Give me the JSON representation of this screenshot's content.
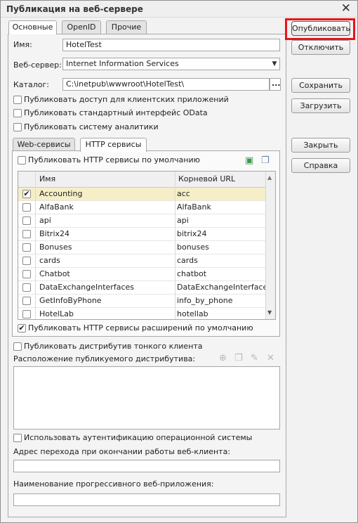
{
  "window": {
    "title": "Публикация на веб-сервере"
  },
  "tabs": [
    {
      "label": "Основные"
    },
    {
      "label": "OpenID"
    },
    {
      "label": "Прочие"
    }
  ],
  "form": {
    "name_label": "Имя:",
    "name_value": "HotelTest",
    "webserver_label": "Веб-сервер:",
    "webserver_value": "Internet Information Services",
    "catalog_label": "Каталог:",
    "catalog_value": "C:\\inetpub\\wwwroot\\HotelTest\\",
    "catalog_button": "...",
    "checks": [
      {
        "label": "Публиковать доступ для клиентских приложений",
        "checked": false
      },
      {
        "label": "Публиковать стандартный интерфейс OData",
        "checked": false
      },
      {
        "label": "Публиковать систему аналитики",
        "checked": false
      }
    ]
  },
  "inner_tabs": [
    {
      "label": "Web-сервисы"
    },
    {
      "label": "HTTP сервисы"
    }
  ],
  "http": {
    "publish_default_label": "Публиковать HTTP сервисы по умолчанию",
    "publish_default_checked": false,
    "col_name": "Имя",
    "col_url": "Корневой URL",
    "rows": [
      {
        "name": "Accounting",
        "url": "acc",
        "checked": true
      },
      {
        "name": "AlfaBank",
        "url": "AlfaBank",
        "checked": false
      },
      {
        "name": "api",
        "url": "api",
        "checked": false
      },
      {
        "name": "Bitrix24",
        "url": "bitrix24",
        "checked": false
      },
      {
        "name": "Bonuses",
        "url": "bonuses",
        "checked": false
      },
      {
        "name": "cards",
        "url": "cards",
        "checked": false
      },
      {
        "name": "Chatbot",
        "url": "chatbot",
        "checked": false
      },
      {
        "name": "DataExchangeInterfaces",
        "url": "DataExchangeInterfaces",
        "checked": false
      },
      {
        "name": "GetInfoByPhone",
        "url": "info_by_phone",
        "checked": false
      },
      {
        "name": "HotelLab",
        "url": "hotellab",
        "checked": false
      }
    ],
    "publish_ext_label": "Публиковать HTTP сервисы расширений по умолчанию",
    "publish_ext_checked": true
  },
  "distrib": {
    "publish_label": "Публиковать дистрибутив тонкого клиента",
    "location_label": "Расположение публикуемого дистрибутива:"
  },
  "bottom": {
    "os_auth_label": "Использовать аутентификацию операционной системы",
    "redirect_label": "Адрес перехода при окончании работы веб-клиента:",
    "redirect_value": "",
    "pwa_label": "Наименование прогрессивного веб-приложения:",
    "pwa_value": ""
  },
  "buttons": {
    "publish": "Опубликовать",
    "disable": "Отключить",
    "save": "Сохранить",
    "load": "Загрузить",
    "close": "Закрыть",
    "help": "Справка"
  },
  "icons": {
    "close": "✕",
    "check": "✔",
    "dropdown": "▼"
  }
}
